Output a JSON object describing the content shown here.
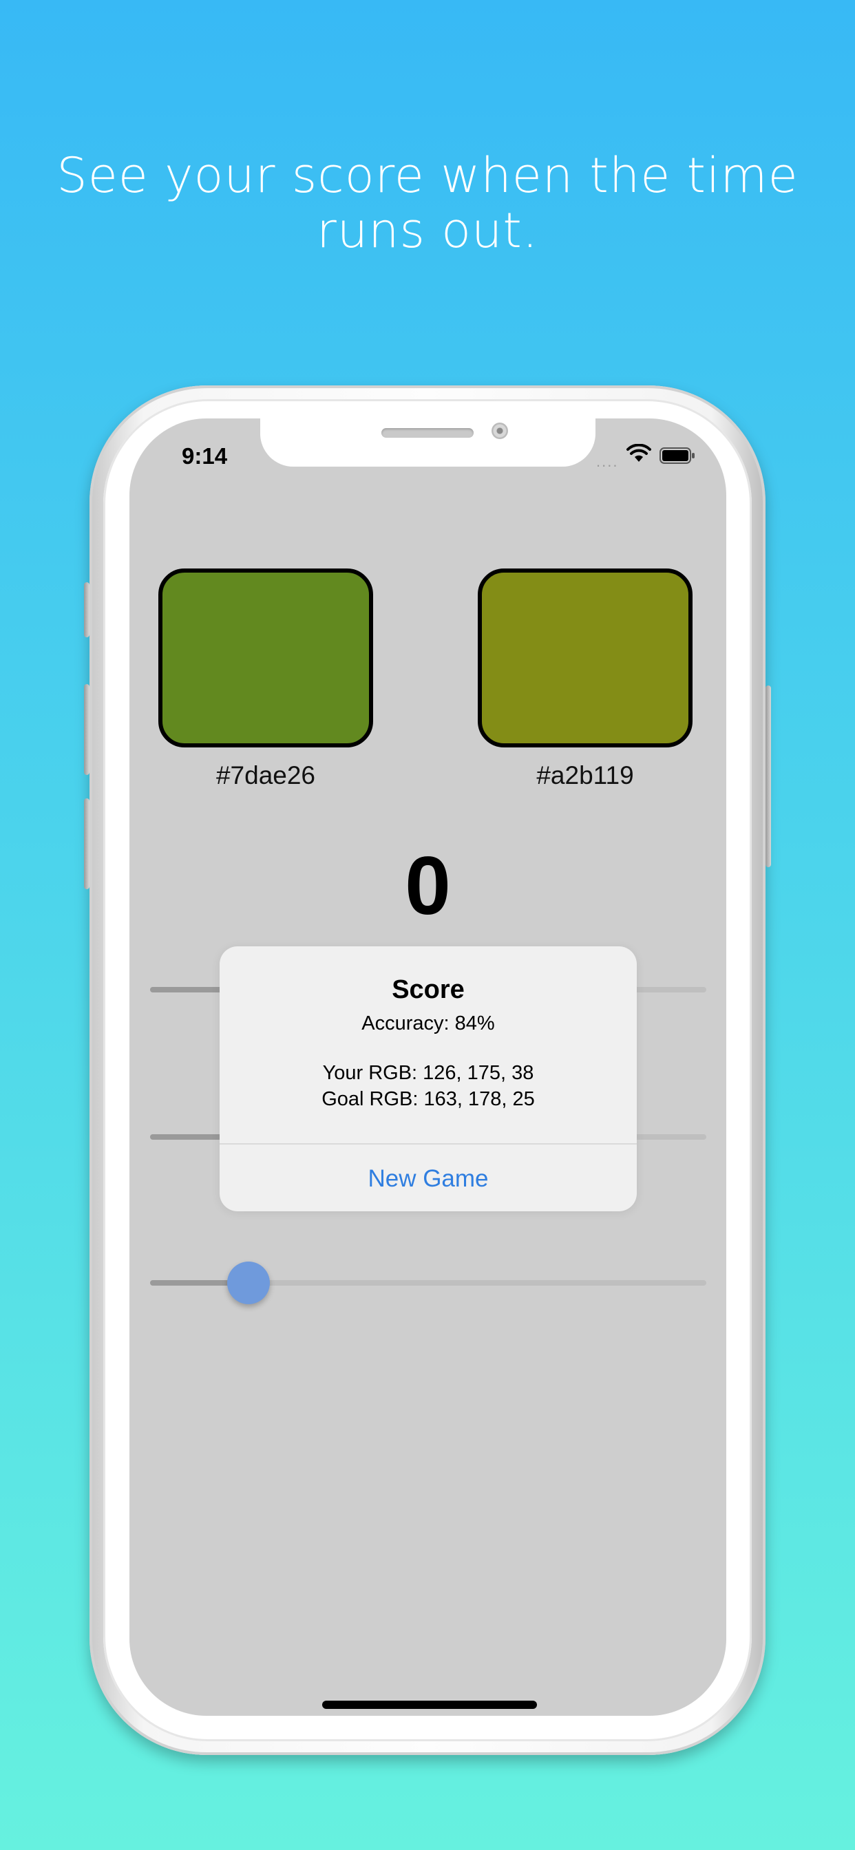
{
  "headline": {
    "line1": "See your score when the time",
    "line2": "runs out."
  },
  "status_bar": {
    "time": "9:14",
    "signal": "....",
    "icons": [
      "wifi-icon",
      "battery-icon"
    ]
  },
  "swatches": {
    "left": {
      "label": "#7dae26",
      "fill": "#62891f"
    },
    "right": {
      "label": "#a2b119",
      "fill": "#838d16"
    }
  },
  "timer": {
    "value": "0"
  },
  "sliders": {
    "third_fill_fraction": 0.17
  },
  "alert": {
    "title": "Score",
    "accuracy": "Accuracy: 84%",
    "your_rgb": "Your RGB: 126, 175, 38",
    "goal_rgb": "Goal RGB: 163, 178, 25",
    "button": "New Game"
  },
  "colors": {
    "background_top": "#38b9f5",
    "background_bottom": "#66f1df",
    "screen": "#cecece",
    "slider_thumb": "#6f9adc",
    "accent": "#2f7ee0"
  }
}
